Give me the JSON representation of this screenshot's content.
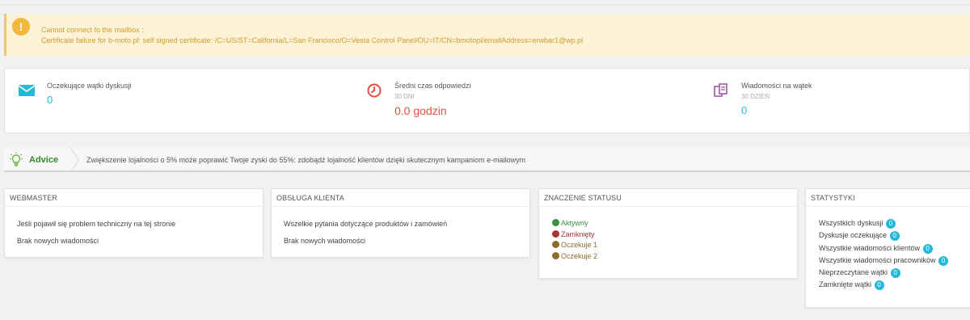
{
  "alert": {
    "line1": "Cannot connect to the mailbox :",
    "line2": "Certificate failure for b-moto.pl: self signed certificate: /C=US/ST=California/L=San Francisco/O=Vesta Control Panel/OU=IT/CN=bmotopl/emailAddress=erwbar1@wp.pl",
    "icon": "warning-icon"
  },
  "kpis": [
    {
      "label": "Oczekujące wątki dyskusji",
      "sublabel": "",
      "value": "0",
      "icon": "envelope-icon"
    },
    {
      "label": "Średni czas odpowiedzi",
      "sublabel": "30 DNI",
      "value": "0.0 godzin",
      "icon": "clock-icon"
    },
    {
      "label": "Wiadomości na wątek",
      "sublabel": "30 DZIEŃ",
      "value": "0",
      "icon": "copy-icon"
    }
  ],
  "advice": {
    "title": "Advice",
    "text": "Zwiększenie lojalności o 5% może poprawić Twoje zyski do 55%: zdobądź lojalność klientów dzięki skutecznym kampaniom e-mailowym",
    "icon": "lightbulb-icon"
  },
  "cards": {
    "webmaster": {
      "title": "WEBMASTER",
      "rows": [
        "Jeśli pojawił się problem techniczny na tej stronie",
        "Brak nowych wiadomości"
      ]
    },
    "customer_service": {
      "title": "OBSŁUGA KLIENTA",
      "rows": [
        "Wszelkie pytania dotyczące produktów i zamówień",
        "Brak nowych wiadomości"
      ]
    },
    "status_meaning": {
      "title": "ZNACZENIE STATUSU",
      "items": [
        {
          "label": "Aktywny",
          "color": "#3f8e3f"
        },
        {
          "label": "Zamknięty",
          "color": "#a83232"
        },
        {
          "label": "Oczekuje 1",
          "color": "#8a6d2c"
        },
        {
          "label": "Oczekuje 2",
          "color": "#8a6d2c"
        }
      ]
    },
    "statistics": {
      "title": "STATYSTYKI",
      "items": [
        {
          "label": "Wszystkich dyskusji",
          "count": "0"
        },
        {
          "label": "Dyskusje oczekujące",
          "count": "0"
        },
        {
          "label": "Wszystkie wiadomości klientów",
          "count": "0"
        },
        {
          "label": "Wszystkie wiadomości pracowników",
          "count": "0"
        },
        {
          "label": "Nieprzeczytane wątki",
          "count": "0"
        },
        {
          "label": "Zamknięte wątki",
          "count": "0"
        }
      ]
    }
  },
  "colors": {
    "accent": "#25b9d7",
    "warning_bg": "#fcf2d6",
    "warning_text": "#d39b2b",
    "danger": "#e84e40",
    "advice_green": "#2f8a2f"
  }
}
